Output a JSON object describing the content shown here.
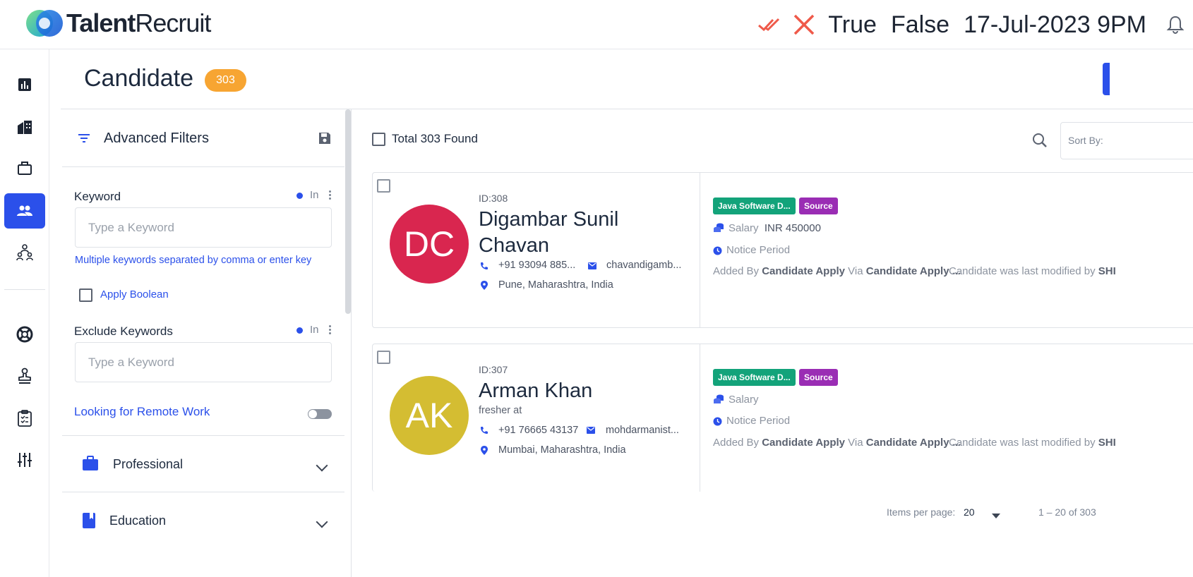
{
  "app": {
    "brand_bold": "Talent",
    "brand_light": "Recruit"
  },
  "topbar": {
    "status_true": "True",
    "status_false": "False",
    "datetime": "17-Jul-2023 9PM"
  },
  "rail": [
    "analytics-icon",
    "company-icon",
    "briefcase-icon",
    "candidates-icon",
    "team-icon",
    "support-icon",
    "stamp-icon",
    "clipboard-icon",
    "sliders-icon"
  ],
  "page": {
    "title": "Candidate",
    "count": "303"
  },
  "filters": {
    "title": "Advanced Filters",
    "keyword_label": "Keyword",
    "in_label": "In",
    "keyword_placeholder": "Type a Keyword",
    "keyword_hint": "Multiple keywords separated by comma or enter key",
    "apply_boolean": "Apply Boolean",
    "exclude_label": "Exclude Keywords",
    "exclude_in_label": "In",
    "exclude_placeholder": "Type a Keyword",
    "remote_label": "Looking for Remote Work",
    "remote_on": false,
    "sections": {
      "professional": "Professional",
      "education": "Education"
    }
  },
  "results": {
    "total": "Total 303 Found",
    "sort_label": "Sort By:",
    "candidates": [
      {
        "initials": "DC",
        "color": "#d9264f",
        "id": "ID:308",
        "name": "Digambar Sunil Chavan",
        "phone": "+91 93094 885...",
        "email": "chavandigamb...",
        "location": "Pune, Maharashtra, India",
        "tag_job": "Java Software D...",
        "tag_source": "Source",
        "salary_label": "Salary",
        "salary_value": "INR 450000",
        "notice": "Notice Period",
        "added_prefix": "Added By ",
        "added_by": "Candidate Apply",
        "via": " Via ",
        "via_value": "Candidate Apply ...",
        "modified_prefix": "Candidate was last modified by ",
        "modified_by": "SHI"
      },
      {
        "initials": "AK",
        "color": "#d4bd32",
        "id": "ID:307",
        "name": "Arman Khan",
        "subtitle": "fresher at",
        "phone": "+91 76665 43137",
        "email": "mohdarmanist...",
        "location": "Mumbai, Maharashtra, India",
        "tag_job": "Java Software D...",
        "tag_source": "Source",
        "salary_label": "Salary",
        "salary_value": "",
        "notice": "Notice Period",
        "added_prefix": "Added By ",
        "added_by": "Candidate Apply",
        "via": " Via ",
        "via_value": "Candidate Apply ...",
        "modified_prefix": "Candidate was last modified by ",
        "modified_by": "SHI"
      }
    ]
  },
  "pagination": {
    "items_per_page_label": "Items per page:",
    "items_per_page": "20",
    "range": "1 – 20 of 303"
  }
}
